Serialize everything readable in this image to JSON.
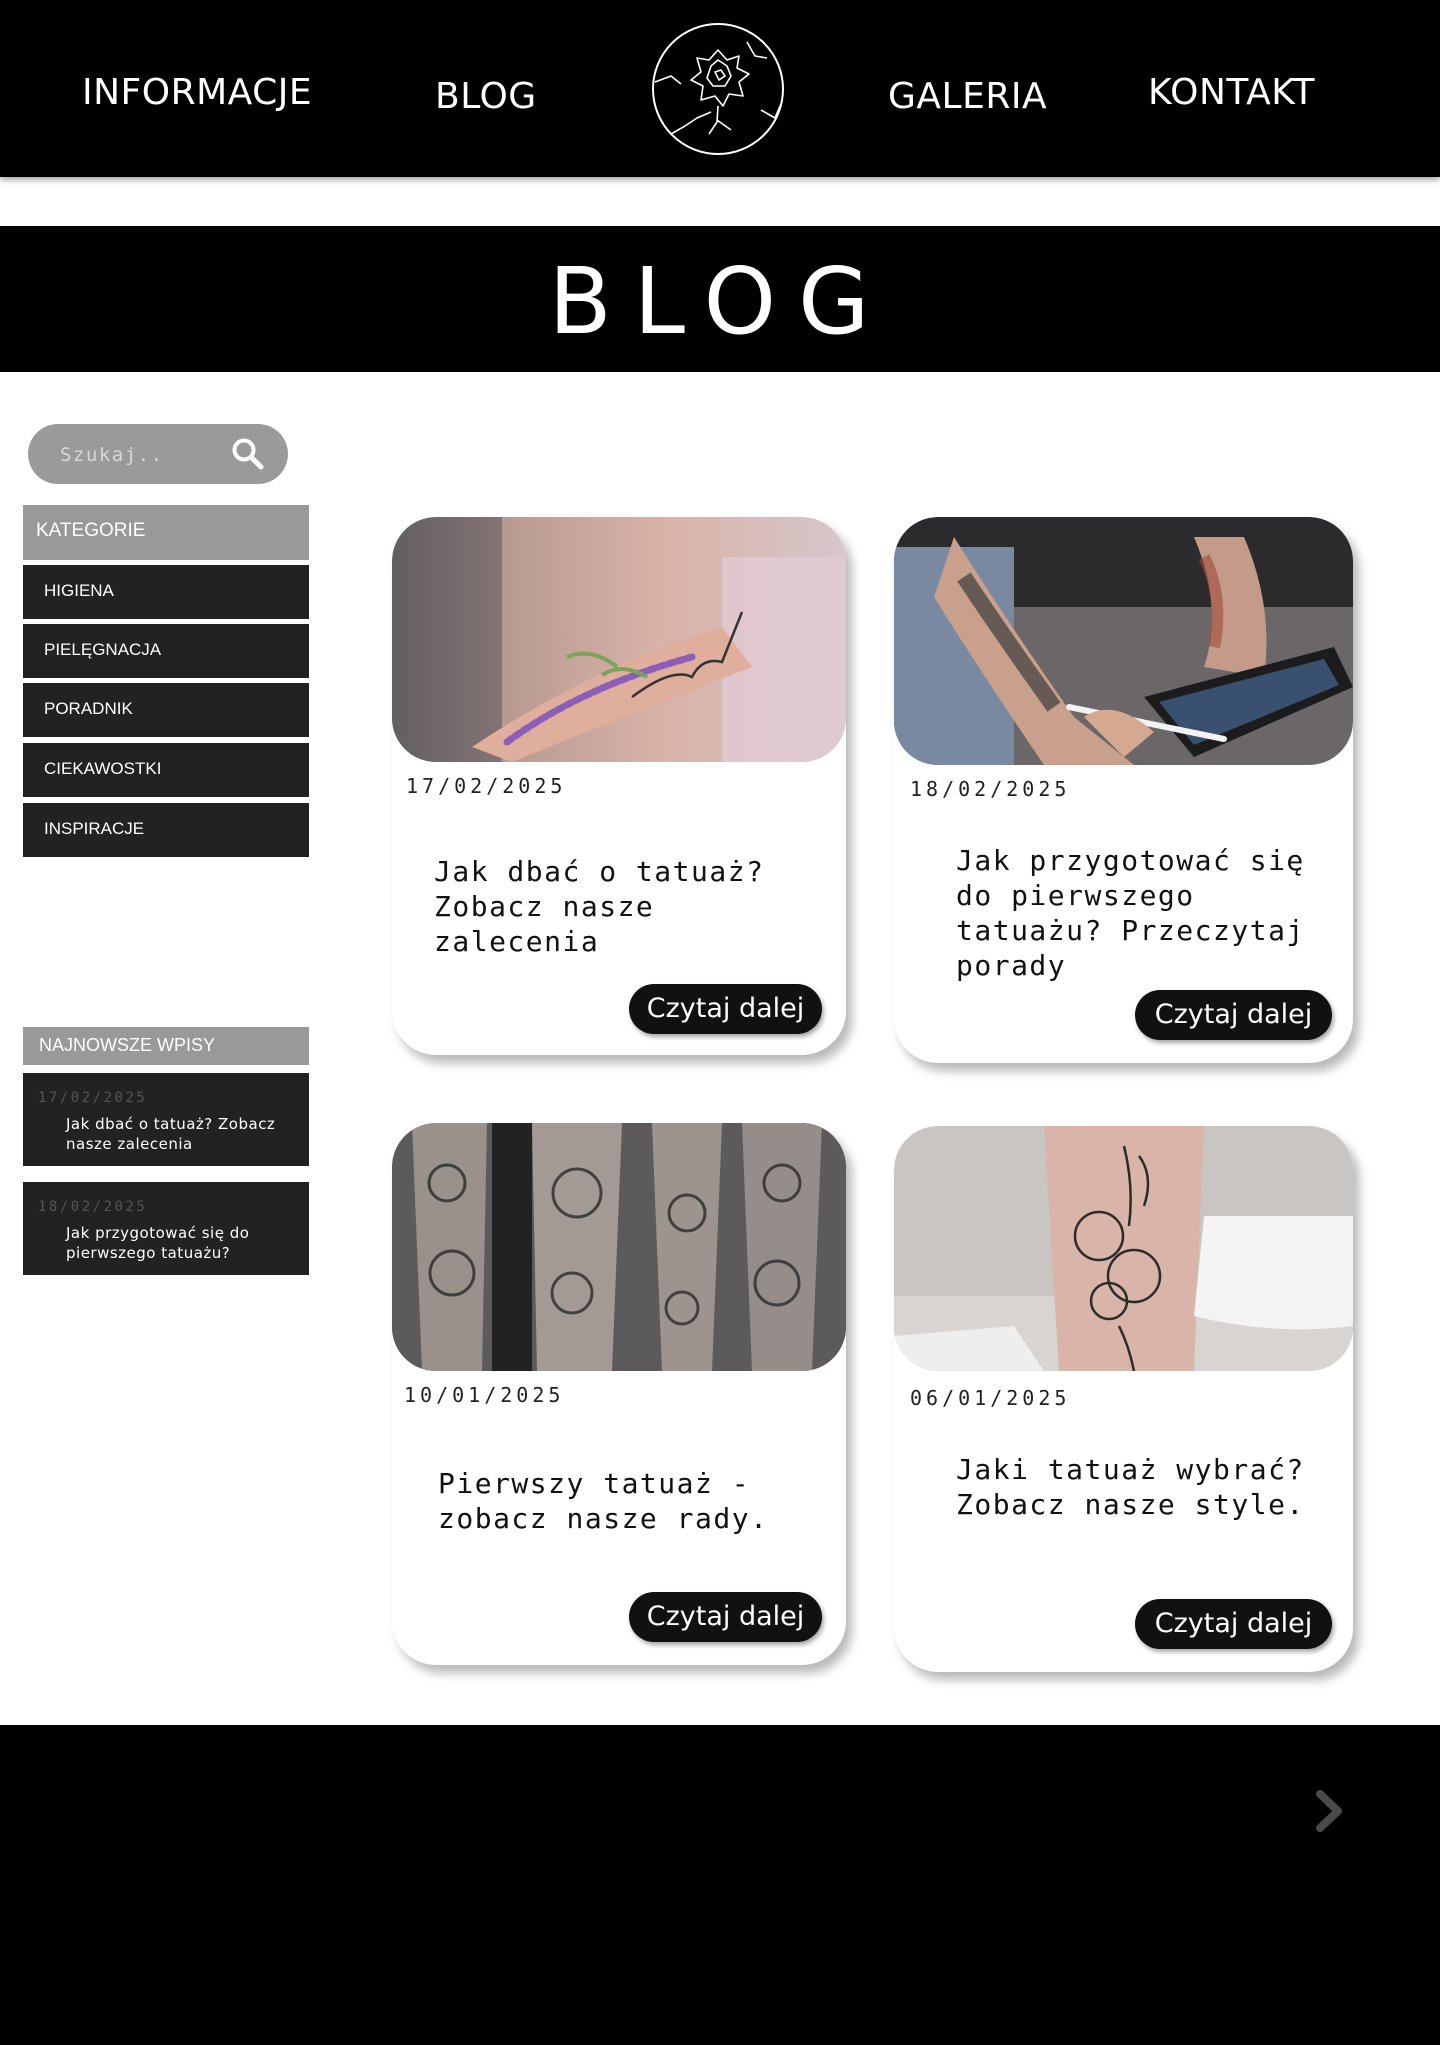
{
  "nav": {
    "informacje": "INFORMACJE",
    "blog": "BLOG",
    "galeria": "GALERIA",
    "kontakt": "KONTAKT",
    "logo_icon": "rose-logo-icon"
  },
  "banner": {
    "title": "BLOG"
  },
  "sidebar": {
    "search": {
      "placeholder": "Szukaj..",
      "icon": "search-icon"
    },
    "categories_header": "KATEGORIE",
    "categories": [
      "HIGIENA",
      "PIELĘGNACJA",
      "PORADNIK",
      "CIEKAWOSTKI",
      "INSPIRACJE"
    ],
    "recent_header": "NAJNOWSZE WPISY",
    "recent": [
      {
        "date": "17/02/2025",
        "title": "Jak dbać o tatuaż? Zobacz nasze zalecenia"
      },
      {
        "date": "18/02/2025",
        "title": "Jak przygotować się do pierwszego tatuażu?"
      }
    ]
  },
  "posts": [
    {
      "date": "17/02/2025",
      "title": "Jak dbać o tatuaż? Zobacz nasze zalecenia",
      "button": "Czytaj dalej",
      "image": "lavender-amor-fati-tattoo-photo"
    },
    {
      "date": "18/02/2025",
      "title": "Jak przygotować się do pierwszego tatuażu? Przeczytaj porady",
      "button": "Czytaj dalej",
      "image": "tattoo-artist-tablet-photo"
    },
    {
      "date": "10/01/2025",
      "title": "Pierwszy tatuaż - zobacz nasze rady.",
      "button": "Czytaj dalej",
      "image": "sleeve-tattoos-photo"
    },
    {
      "date": "06/01/2025",
      "title": "Jaki tatuaż wybrać? Zobacz nasze style.",
      "button": "Czytaj dalej",
      "image": "floral-leg-tattoo-photo"
    }
  ],
  "footer": {
    "next_icon": "chevron-right-icon"
  },
  "colors": {
    "black": "#000000",
    "button": "#111111",
    "category_header": "#999999",
    "category_item": "#222222"
  }
}
